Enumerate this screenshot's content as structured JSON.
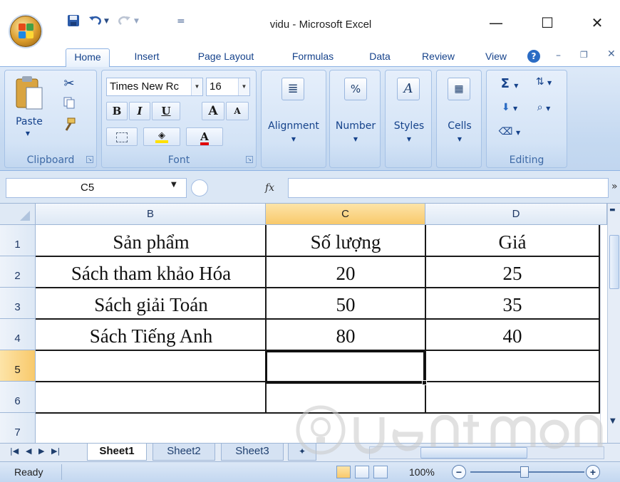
{
  "window": {
    "title": "vidu - Microsoft Excel",
    "minimize": "—",
    "maximize": "☐",
    "close": "✕"
  },
  "qat": {
    "save_icon": "floppy-disk-icon",
    "undo_icon": "undo-icon",
    "redo_icon": "redo-icon",
    "customize": "="
  },
  "ribbon": {
    "tabs": [
      "Home",
      "Insert",
      "Page Layout",
      "Formulas",
      "Data",
      "Review",
      "View"
    ],
    "active_tab": "Home",
    "clipboard": {
      "label": "Clipboard",
      "paste": "Paste"
    },
    "font": {
      "label": "Font",
      "name": "Times New Rc",
      "size": "16",
      "bold": "B",
      "italic": "I",
      "underline": "U",
      "grow": "A",
      "shrink": "A"
    },
    "alignment": {
      "label": "Alignment"
    },
    "number": {
      "label": "Number",
      "icon_text": "%"
    },
    "styles": {
      "label": "Styles"
    },
    "cells": {
      "label": "Cells"
    },
    "editing": {
      "label": "Editing",
      "sum": "Σ"
    }
  },
  "formula_bar": {
    "name_box": "C5",
    "fx": "fx",
    "formula": ""
  },
  "sheet": {
    "columns": [
      "B",
      "C",
      "D"
    ],
    "selected_column": "C",
    "rows": [
      "1",
      "2",
      "3",
      "4",
      "5",
      "6",
      "7"
    ],
    "selected_row": "5",
    "active_cell": "C5",
    "data": [
      [
        "Sản phẩm",
        "Số lượng",
        "Giá"
      ],
      [
        "Sách tham khảo Hóa",
        "20",
        "25"
      ],
      [
        "Sách giải Toán",
        "50",
        "35"
      ],
      [
        "Sách Tiếng Anh",
        "80",
        "40"
      ],
      [
        "",
        "",
        ""
      ],
      [
        "",
        "",
        ""
      ],
      [
        "",
        "",
        ""
      ]
    ]
  },
  "sheet_tabs": {
    "tabs": [
      "Sheet1",
      "Sheet2",
      "Sheet3"
    ],
    "active": "Sheet1"
  },
  "status": {
    "text": "Ready",
    "zoom": "100%",
    "zoom_minus": "−",
    "zoom_plus": "+"
  },
  "colors": {
    "ribbon_blue": "#c5d9f1",
    "header_selected": "#f8c96b",
    "accent_text": "#15428b"
  }
}
